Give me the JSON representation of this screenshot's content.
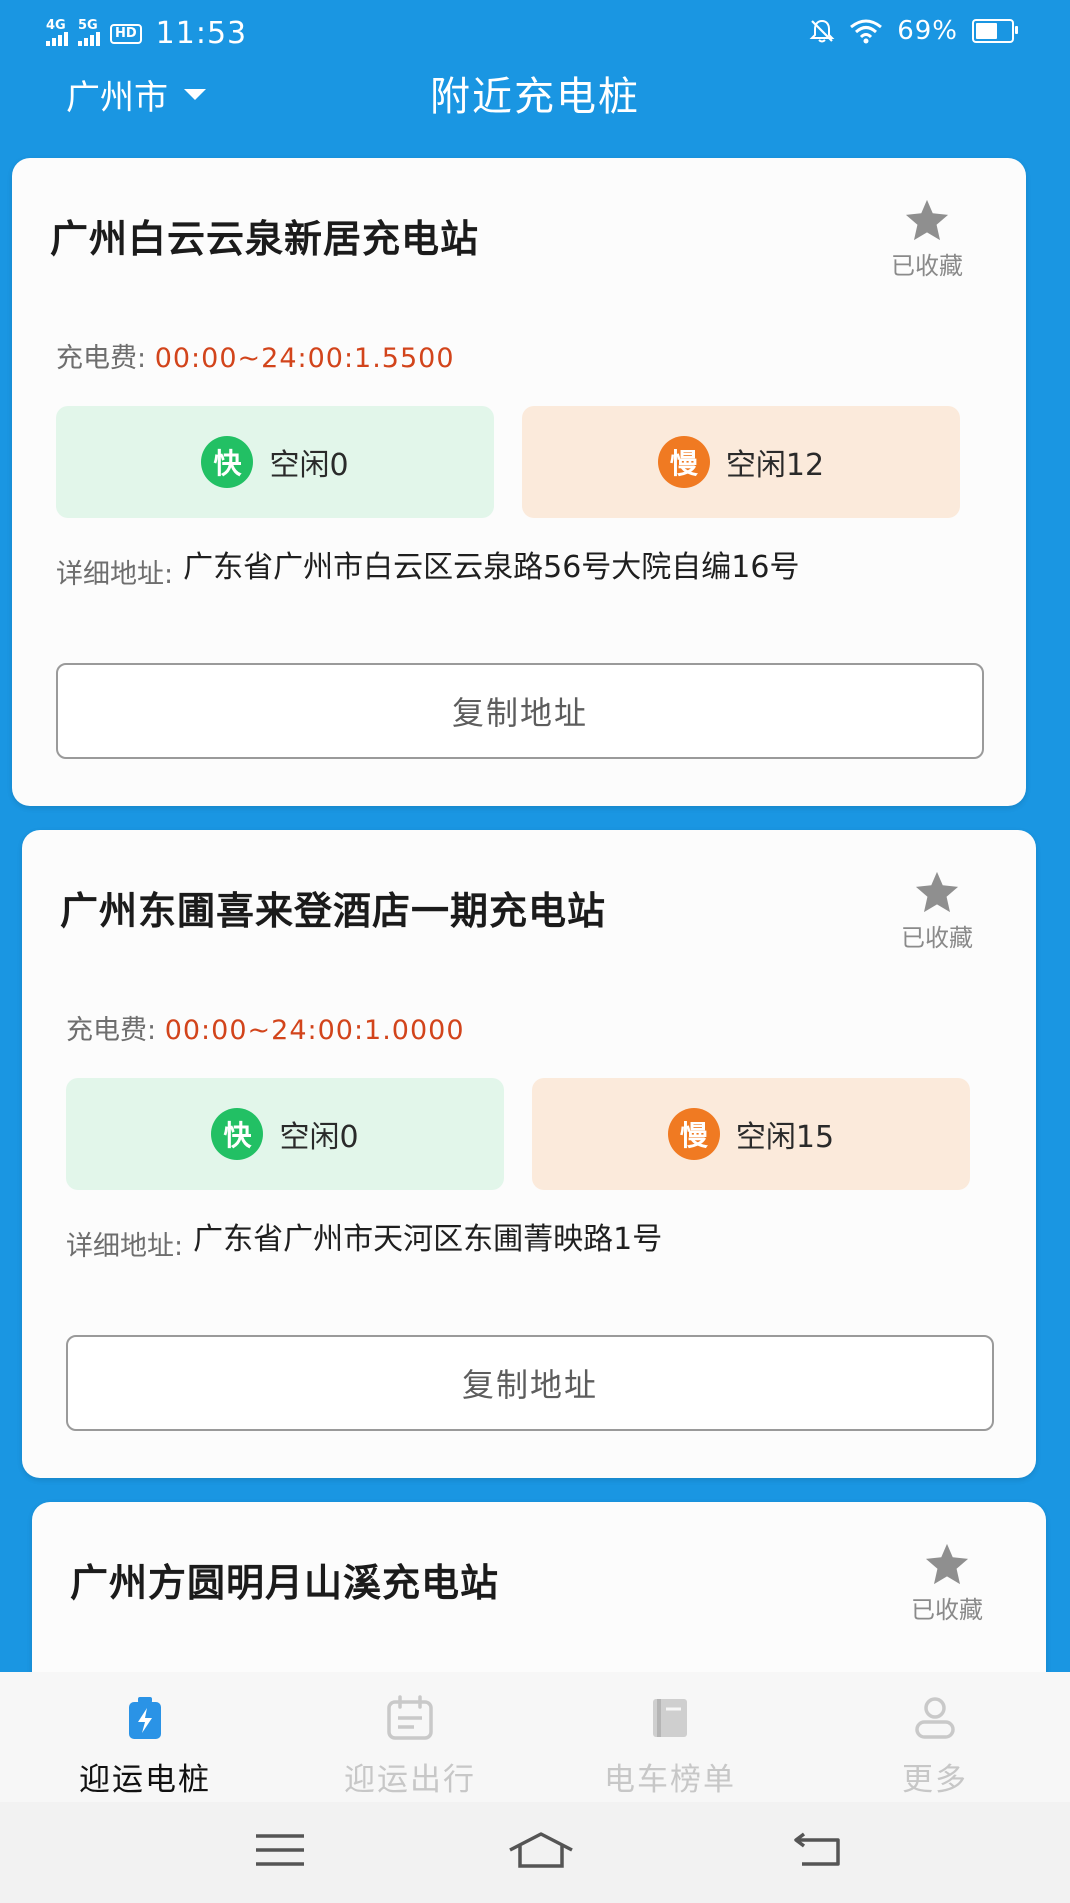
{
  "status_bar": {
    "network_1": "4G",
    "network_2": "5G",
    "hd_badge": "HD",
    "time": "11:53",
    "battery_percent": "69%",
    "battery_level": 0.69
  },
  "header": {
    "city": "广州市",
    "title": "附近充电桩"
  },
  "stations": [
    {
      "name": "广州白云云泉新居充电站",
      "favorite_label": "已收藏",
      "fee_label": "充电费:",
      "fee_value": "00:00~24:00:1.5500",
      "fast_badge": "快",
      "fast_text": "空闲0",
      "slow_badge": "慢",
      "slow_text": "空闲12",
      "address_label": "详细地址:",
      "address": "广东省广州市白云区云泉路56号大院自编16号",
      "copy_label": "复制地址"
    },
    {
      "name": "广州东圃喜来登酒店一期充电站",
      "favorite_label": "已收藏",
      "fee_label": "充电费:",
      "fee_value": "00:00~24:00:1.0000",
      "fast_badge": "快",
      "fast_text": "空闲0",
      "slow_badge": "慢",
      "slow_text": "空闲15",
      "address_label": "详细地址:",
      "address": "广东省广州市天河区东圃菁映路1号",
      "copy_label": "复制地址"
    },
    {
      "name": "广州方圆明月山溪充电站",
      "favorite_label": "已收藏"
    }
  ],
  "bottom_nav": [
    {
      "label": "迎运电桩",
      "icon": "charging-pile-icon",
      "active": true
    },
    {
      "label": "迎运出行",
      "icon": "calendar-icon",
      "active": false
    },
    {
      "label": "电车榜单",
      "icon": "book-icon",
      "active": false
    },
    {
      "label": "更多",
      "icon": "person-icon",
      "active": false
    }
  ],
  "colors": {
    "primary_blue": "#1a96e2",
    "fee_red": "#d2441b",
    "fast_green": "#22c064",
    "slow_orange": "#f07a22"
  }
}
